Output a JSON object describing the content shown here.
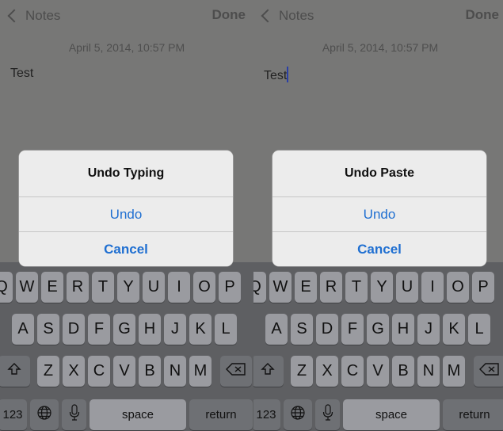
{
  "panels": [
    {
      "nav": {
        "back_label": "Notes",
        "done_label": "Done"
      },
      "date": "April 5, 2014, 10:57 PM",
      "note_text": "Test",
      "alert": {
        "title": "Undo Typing",
        "action_label": "Undo",
        "cancel_label": "Cancel"
      }
    },
    {
      "nav": {
        "back_label": "Notes",
        "done_label": "Done"
      },
      "date": "April 5, 2014, 10:57 PM",
      "note_text": "Test",
      "alert": {
        "title": "Undo Paste",
        "action_label": "Undo",
        "cancel_label": "Cancel"
      }
    }
  ],
  "keyboard": {
    "row1": [
      "Q",
      "W",
      "E",
      "R",
      "T",
      "Y",
      "U",
      "I",
      "O",
      "P"
    ],
    "row2": [
      "A",
      "S",
      "D",
      "F",
      "G",
      "H",
      "J",
      "K",
      "L"
    ],
    "row3": [
      "Z",
      "X",
      "C",
      "V",
      "B",
      "N",
      "M"
    ],
    "numbers_label": "123",
    "space_label": "space",
    "return_label": "return"
  },
  "colors": {
    "alert_button": "#1f6fd1",
    "cursor": "#2a3fa6"
  }
}
